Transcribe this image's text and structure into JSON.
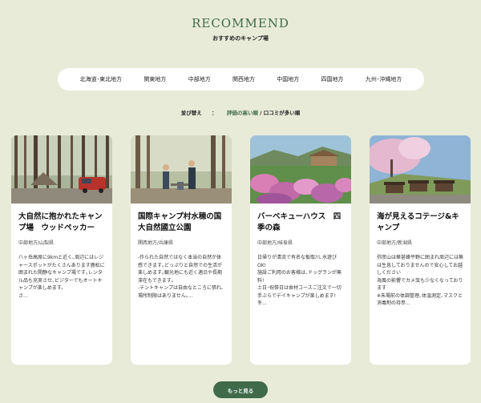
{
  "header": {
    "title": "RECOMMEND",
    "subtitle": "おすすめのキャンプ場"
  },
  "regions": [
    "北海道･東北地方",
    "関東地方",
    "中部地方",
    "関西地方",
    "中国地方",
    "四国地方",
    "九州･沖縄地方"
  ],
  "sort": {
    "label": "並び替え",
    "colon": "：",
    "option1": "評価の高い順",
    "slash": "/",
    "option2": "口コミが多い順"
  },
  "cards": [
    {
      "title": "大自然に抱かれたキャンプ場　ウッドペッカー",
      "location": "中部地方/山梨県",
      "description": "八ヶ岳高原に9kmと近く､周辺にはレジャースポットがたくさんあります鹿松に囲まれた開静なキャンプ場です｡レンタル品も充実させ､ビジターでもオートキャンプが楽しめます。\nさ..."
    },
    {
      "title": "国際キャンプ村水穂の国大自然國立公園",
      "location": "関西地方/兵庫県",
      "description": "-作られた自然ではなく本当の自然が体感できます｡どっぷりと自然での生活が楽しめます｡観光地にも近く適沿や長期滞在もできます｡\n-テントキャンプは自由なところに張れ､場所制限はありません｡..."
    },
    {
      "title": "バーベキューハウス　四季の森",
      "location": "中部地方/岐阜県",
      "description": "日帰りが清流で有名な板取川､水遊びOK!\n施設ご利用のお客様は､ドッグランが無料!\n土日･祝祭日は食材コースご注文で一切手ぶらでデイキャンプが楽しめます!\n冬..."
    },
    {
      "title": "海が見えるコテージ&キャンプ",
      "location": "中部地方/新潟県",
      "description": "弥彦山は華甚峰平野に囲まれ周辺には無は生息しておりませんので安心してお越しください\n海風の影響でカメ虫も少なくなっております\n※朱場前の体調管理､体温測定､マスクと消毒剤の持参..."
    }
  ],
  "more_button": "もっと見る",
  "colors": {
    "background": "#e9ebd9",
    "accent": "#3f6b4a",
    "card": "#ffffff"
  }
}
